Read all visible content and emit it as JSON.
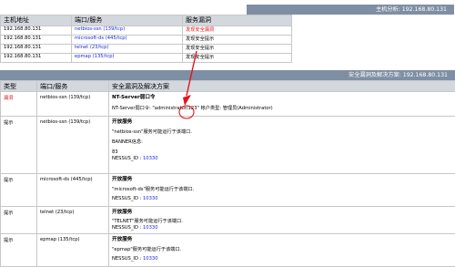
{
  "host_panel": {
    "title": "主机分析: 192.168.80.131",
    "headers": [
      "主机地址",
      "端口/服务",
      "服务漏洞"
    ],
    "rows": [
      {
        "host": "192.168.80.131",
        "service": "netbios-ssn (139/tcp)",
        "status": "发现安全漏洞"
      },
      {
        "host": "192.168.80.131",
        "service": "microsoft-ds (445/tcp)",
        "status": "发现安全提示"
      },
      {
        "host": "192.168.80.131",
        "service": "telnet (23/tcp)",
        "status": "发现安全提示"
      },
      {
        "host": "192.168.80.131",
        "service": "epmap (135/tcp)",
        "status": "发现安全提示"
      }
    ]
  },
  "vuln_panel": {
    "title": "安全漏洞及解决方案: 192.168.80.131",
    "headers": [
      "类型",
      "端口/服务",
      "安全漏洞及解决方案"
    ],
    "rows": [
      {
        "type": "漏洞",
        "service": "netbios-ssn (139/tcp)",
        "heading": "NT-Server弱口令",
        "lines": [
          "NT-Server弱口令: \"administrator/123\" 帐户类型: 管理员(Administrator)"
        ]
      },
      {
        "type": "提示",
        "service": "netbios-ssn (139/tcp)",
        "heading": "开放服务",
        "lines": [
          "\"netbios-ssn\"服务可能运行于该端口.",
          "BANNER信息:",
          "83",
          "NESSUS_ID : 10330"
        ]
      },
      {
        "type": "提示",
        "service": "microsoft-ds (445/tcp)",
        "heading": "开放服务",
        "lines": [
          "\"microsoft-ds\"服务可能运行于该端口.",
          "NESSUS_ID : 10330"
        ]
      },
      {
        "type": "提示",
        "service": "telnet (23/tcp)",
        "heading": "开放服务",
        "lines": [
          "\"TELNET\"服务可能运行于该端口.",
          "NESSUS_ID : 10330"
        ]
      },
      {
        "type": "提示",
        "service": "epmap (135/tcp)",
        "heading": "开放服务",
        "lines": [
          "\"epmap\"服务可能运行于该端口.",
          "NESSUS_ID : 10330"
        ]
      }
    ]
  },
  "colors": {
    "header_bar": "#7f8fa3",
    "table_header": "#d3d8df",
    "link": "#1c2bd2",
    "alert": "#e0161a",
    "annotation": "#e0161a"
  }
}
